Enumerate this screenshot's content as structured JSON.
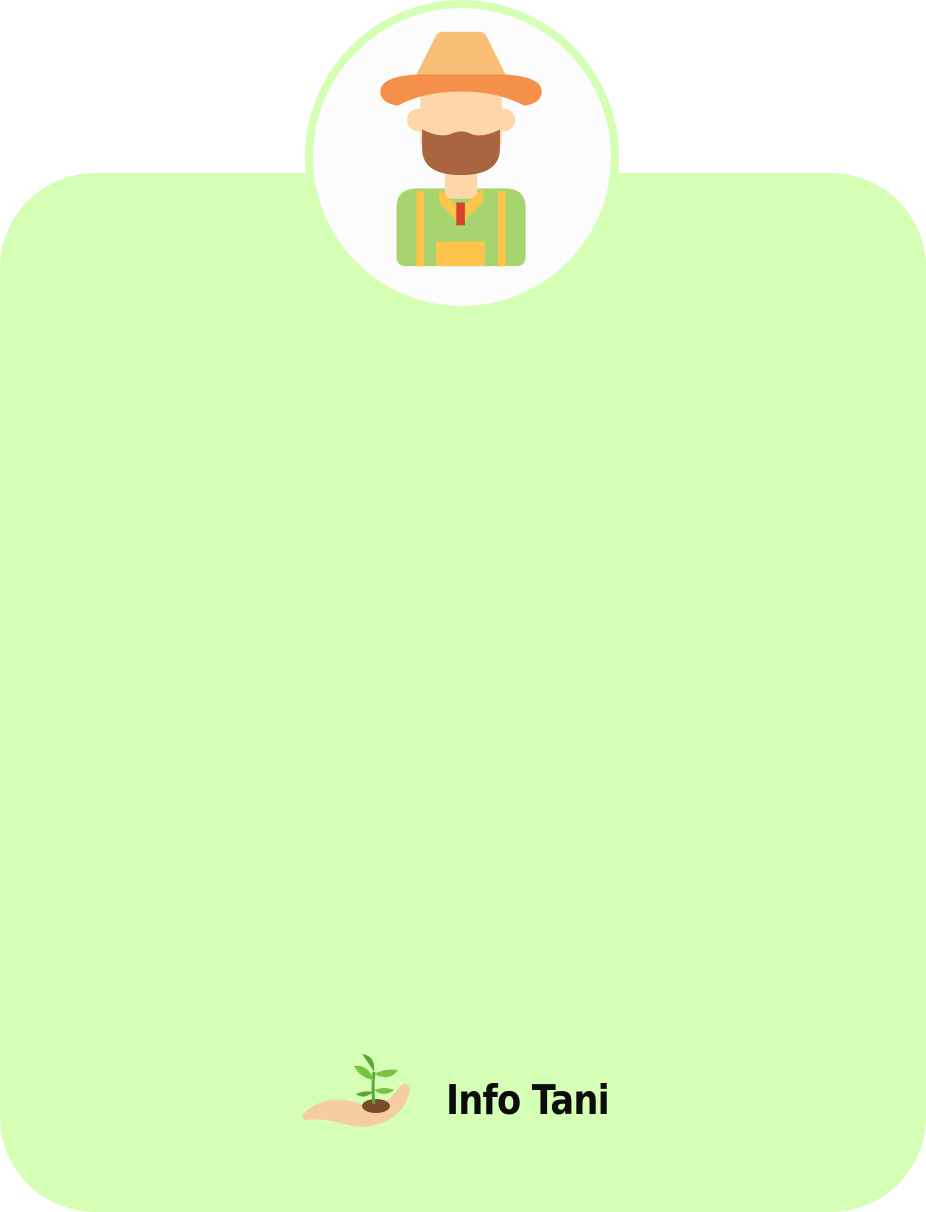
{
  "brand": {
    "name": "Info Tani",
    "logo_icon": "seedling-in-hand-icon"
  },
  "avatar": {
    "icon": "farmer-avatar-icon"
  },
  "colors": {
    "card_background": "#d4ffb4",
    "avatar_background": "#fcfcfc",
    "hat": "#f9bf76",
    "hat_brim": "#f4904a",
    "skin": "#fdd6aa",
    "beard": "#a86540",
    "shirt": "#a8d46f",
    "overalls": "#ffc54a",
    "tie": "#d2422c",
    "leaf": "#7cc242"
  }
}
